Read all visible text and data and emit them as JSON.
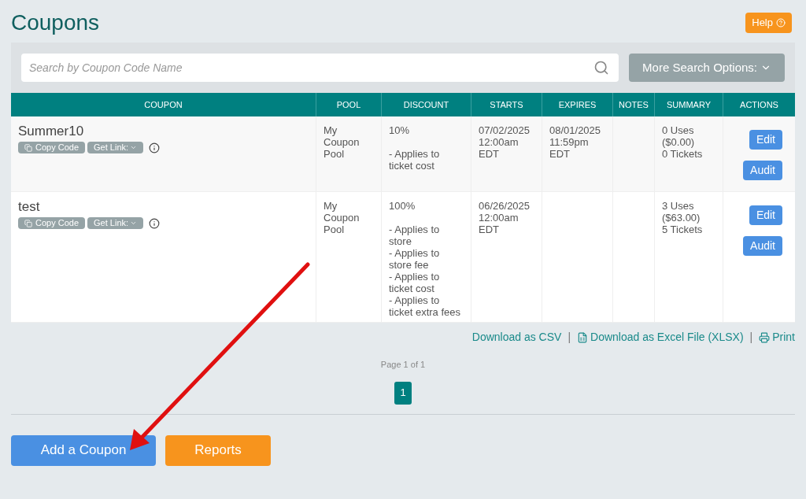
{
  "page": {
    "title": "Coupons",
    "help_button": "Help"
  },
  "search": {
    "placeholder": "Search by Coupon Code Name",
    "more_options": "More Search Options:"
  },
  "table": {
    "columns": [
      "COUPON",
      "POOL",
      "DISCOUNT",
      "STARTS",
      "EXPIRES",
      "NOTES",
      "SUMMARY",
      "ACTIONS"
    ],
    "rows": [
      {
        "name": "Summer10",
        "copy_button": "Copy Code",
        "link_button": "Get Link:",
        "pool": [
          "My",
          "Coupon",
          "Pool"
        ],
        "discount": "10%",
        "discount_notes": [
          "- Applies to ticket cost"
        ],
        "starts": [
          "07/02/2025",
          "12:00am",
          "EDT"
        ],
        "expires": [
          "08/01/2025",
          "11:59pm",
          "EDT"
        ],
        "summary": [
          "0 Uses",
          "($0.00)",
          "0 Tickets"
        ],
        "actions": [
          "Edit",
          "Audit"
        ]
      },
      {
        "name": "test",
        "copy_button": "Copy Code",
        "link_button": "Get Link:",
        "pool": [
          "My",
          "Coupon",
          "Pool"
        ],
        "discount": "100%",
        "discount_notes": [
          "- Applies to store",
          "- Applies to store fee",
          "- Applies to ticket cost",
          "- Applies to ticket extra fees"
        ],
        "starts": [
          "06/26/2025",
          "12:00am",
          "EDT"
        ],
        "expires": [],
        "summary": [
          "3 Uses",
          "($63.00)",
          "5 Tickets"
        ],
        "actions": [
          "Edit",
          "Audit"
        ]
      }
    ]
  },
  "download_separator": "|",
  "downloads": [
    {
      "kind": "csv",
      "label": "Download as CSV"
    },
    {
      "kind": "excel",
      "label": "Download as Excel File (XLSX)"
    },
    {
      "kind": "print",
      "label": "Print"
    }
  ],
  "pagination": {
    "summary": "Page 1 of 1",
    "pages": [
      {
        "label": "1",
        "selected": true
      }
    ]
  },
  "footer_buttons": [
    {
      "kind": "primary",
      "label": "Add a Coupon"
    },
    {
      "kind": "secondary",
      "label": "Reports"
    }
  ]
}
